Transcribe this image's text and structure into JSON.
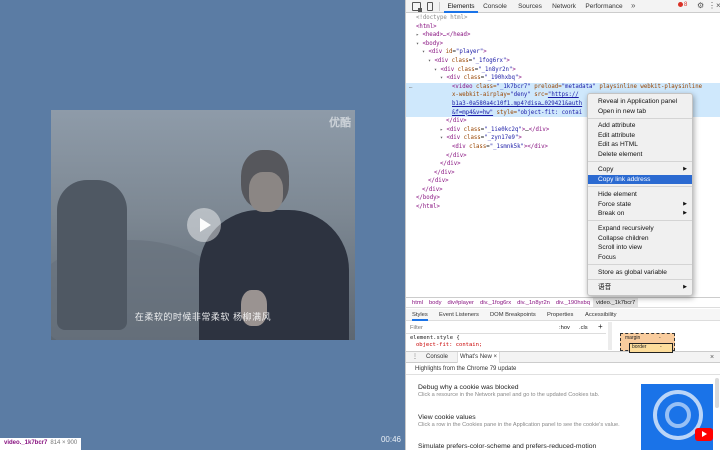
{
  "video": {
    "watermark": "优酷",
    "subtitle": "在柔软的时候非常柔软  杨柳满风",
    "time": "00:46"
  },
  "inspect_tooltip": {
    "tag": "video._1k7bcr7",
    "size": "814 × 900"
  },
  "devtools": {
    "tabs": [
      "Elements",
      "Console",
      "Sources",
      "Network",
      "Performance"
    ],
    "active_tab": "Elements",
    "more_tabs": "»",
    "error_count": "8",
    "icons": [
      "inspect-icon",
      "device-toolbar-icon",
      "gear-icon",
      "kebab-icon",
      "close-icon"
    ]
  },
  "dom": {
    "doctype": "<!doctype html>",
    "html_open": "<html>",
    "head": "<head>…</head>",
    "body_open": "<body>",
    "player_tag": "<div",
    "player_attr": "id",
    "player_val": "\"player\"",
    "div1_val": "\"_1fog6rx\"",
    "div2_val": "\"_1n8yr2n\"",
    "div3_val": "\"_190hxbq\"",
    "video_line1_a": "<video",
    "video_line1_b": "class=",
    "video_line1_c": "\"_1k7bcr7\"",
    "video_line1_d": "preload=",
    "video_line1_e": "\"metadata\"",
    "video_line1_f": "playsinline webkit-playsinline",
    "video_line2_a": "x-webkit-airplay=",
    "video_line2_b": "\"deny\"",
    "video_line2_c": "src=",
    "video_line2_d": "\"https://",
    "video_line3": "b1a3-0a580a4c10f1.mp4?disa…029421&auth",
    "video_line4_a": "&f=mp4&v=hw\"",
    "video_line4_b": "style=",
    "video_line4_c": "\"object-fit: contai",
    "div_close": "</div>",
    "div4_val": "\"_1ie0kc2q\"",
    "div5_val": "\"_zyn17e9\"",
    "div6_val": "\"_1smnk5k\"",
    "body_close": "</body>",
    "html_close": "</html>",
    "ellipsis": "…",
    "class_attr": "class",
    "inline_dots": "…"
  },
  "context_menu": {
    "items": [
      "Reveal in Application panel",
      "Open in new tab",
      "Add attribute",
      "Edit attribute",
      "Edit as HTML",
      "Delete element",
      "Copy",
      "Copy link address",
      "Hide element",
      "Force state",
      "Break on",
      "Expand recursively",
      "Collapse children",
      "Scroll into view",
      "Focus",
      "Store as global variable",
      "语音"
    ],
    "highlighted": "Copy link address"
  },
  "breadcrumbs": [
    "html",
    "body",
    "div#player",
    "div._1fog6rx",
    "div._1n8yr2n",
    "div._190hxbq",
    "video._1k7bcr7"
  ],
  "styles": {
    "subtabs": [
      "Styles",
      "Event Listeners",
      "DOM Breakpoints",
      "Properties",
      "Accessibility"
    ],
    "filter_placeholder": "Filter",
    "hov": ":hov",
    ".cls": ".cls",
    "plus": "+",
    "rule_selector": "element.style {",
    "rule_prop": "object-fit: contain;",
    "box_margin_label": "margin",
    "box_margin_value": "-",
    "box_border_label": "border",
    "box_border_value": "-"
  },
  "drawer": {
    "tabs": [
      "Console",
      "What's New"
    ],
    "active": "What's New",
    "header": "Highlights from the Chrome 79 update",
    "items": [
      {
        "title": "Debug why a cookie was blocked",
        "desc": "Click a resource in the Network panel and go to the updated Cookies tab."
      },
      {
        "title": "View cookie values",
        "desc": "Click a row in the Cookies pane in the Application panel to see the cookie's value."
      },
      {
        "title": "Simulate prefers-color-scheme and prefers-reduced-motion",
        "desc": ""
      }
    ]
  }
}
